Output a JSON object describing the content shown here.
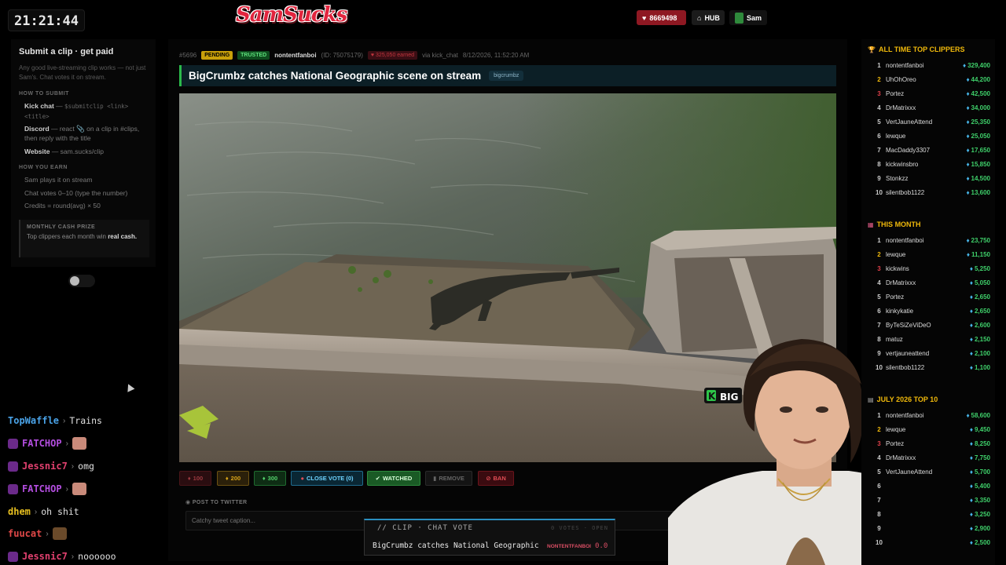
{
  "top_bar": {
    "clock": "21:21:44",
    "logo_text": "SamSucks",
    "points": "8669498",
    "hub_label": "HUB",
    "user_name": "Sam"
  },
  "info_panel": {
    "title": "Submit a clip · get paid",
    "description": "Any good live-streaming clip works — not just Sam's. Chat votes it on stream.",
    "how_to_submit_heading": "HOW TO SUBMIT",
    "submit_steps": [
      {
        "name": "Kick chat",
        "detail": "$submitclip <link> <title>"
      },
      {
        "name": "Discord",
        "detail": "— react 📎 on a clip in #clips, then reply with the title"
      },
      {
        "name": "Website",
        "detail": "— sam.sucks/clip"
      }
    ],
    "how_you_earn_heading": "HOW YOU EARN",
    "earn_steps": [
      "Sam plays it on stream",
      "Chat votes 0–10 (type the number)",
      "Credits = round(avg) × 50"
    ],
    "prize_heading": "MONTHLY CASH PRIZE",
    "prize_text": "Top clippers each month win",
    "prize_bold": "real cash."
  },
  "chat": [
    {
      "user": "TopWaffle",
      "color": "#4aa3e8",
      "message": "Trains",
      "badge": false,
      "emote": null
    },
    {
      "user": "FATCHOP",
      "color": "#b44ee0",
      "message": "",
      "badge": true,
      "emote": "face-emote"
    },
    {
      "user": "Jessnic7",
      "color": "#e0406e",
      "message": "omg",
      "badge": true,
      "emote": null
    },
    {
      "user": "FATCHOP",
      "color": "#b44ee0",
      "message": "",
      "badge": true,
      "emote": "face-emote"
    },
    {
      "user": "dhem",
      "color": "#e8c020",
      "message": "oh shit",
      "badge": false,
      "emote": null
    },
    {
      "user": "fuucat",
      "color": "#e04848",
      "message": "",
      "badge": false,
      "emote": "cat-emote"
    },
    {
      "user": "Jessnic7",
      "color": "#e0406e",
      "message": "noooooo",
      "badge": true,
      "emote": null
    }
  ],
  "clip": {
    "number": "#5696",
    "status": "PENDING",
    "trust": "TRUSTED",
    "submitter": "nontentfanboi",
    "submitter_id": "(ID: 75075179)",
    "earned": "325,050 earned",
    "source": "via kick_chat",
    "timestamp": "8/12/2026, 11:52:20 AM",
    "title": "BigCrumbz catches National Geographic scene on stream",
    "tag": "bigcrumbz",
    "watermark": "BIG"
  },
  "actions": {
    "vote_100": "100",
    "vote_200": "200",
    "vote_300": "300",
    "close_vote": "CLOSE VOTE (0)",
    "watched": "WATCHED",
    "remove": "REMOVE",
    "ban": "BAN"
  },
  "tweet": {
    "label": "POST TO TWITTER",
    "placeholder": "Catchy tweet caption..."
  },
  "vote_overlay": {
    "header": "// CLIP · CHAT VOTE",
    "status": "0 VOTES · OPEN",
    "title": "BigCrumbz catches National Geographic",
    "user": "NONTENTFANBOI",
    "score": "0.0"
  },
  "boards": {
    "all_time": {
      "title": "ALL TIME TOP CLIPPERS",
      "rows": [
        {
          "rank": "1",
          "name": "nontentfanboi",
          "value": "329,400"
        },
        {
          "rank": "2",
          "name": "UhOhOreo",
          "value": "44,200"
        },
        {
          "rank": "3",
          "name": "Portez",
          "value": "42,500"
        },
        {
          "rank": "4",
          "name": "DrMatrixxx",
          "value": "34,000"
        },
        {
          "rank": "5",
          "name": "VertJauneAttend",
          "value": "25,350"
        },
        {
          "rank": "6",
          "name": "lewque",
          "value": "25,050"
        },
        {
          "rank": "7",
          "name": "MacDaddy3307",
          "value": "17,650"
        },
        {
          "rank": "8",
          "name": "kickwinsbro",
          "value": "15,850"
        },
        {
          "rank": "9",
          "name": "Stonkzz",
          "value": "14,500"
        },
        {
          "rank": "10",
          "name": "silentbob1122",
          "value": "13,600"
        }
      ]
    },
    "this_month": {
      "title": "THIS MONTH",
      "rows": [
        {
          "rank": "1",
          "name": "nontentfanboi",
          "value": "23,750"
        },
        {
          "rank": "2",
          "name": "lewque",
          "value": "11,150"
        },
        {
          "rank": "3",
          "name": "kickwins",
          "value": "5,250"
        },
        {
          "rank": "4",
          "name": "DrMatrixxx",
          "value": "5,050"
        },
        {
          "rank": "5",
          "name": "Portez",
          "value": "2,650"
        },
        {
          "rank": "6",
          "name": "kinkykatie",
          "value": "2,650"
        },
        {
          "rank": "7",
          "name": "ByTeSiZeViDeO",
          "value": "2,600"
        },
        {
          "rank": "8",
          "name": "matuz",
          "value": "2,150"
        },
        {
          "rank": "9",
          "name": "vertjauneattend",
          "value": "2,100"
        },
        {
          "rank": "10",
          "name": "silentbob1122",
          "value": "1,100"
        }
      ]
    },
    "july": {
      "title": "JULY 2026 TOP 10",
      "rows": [
        {
          "rank": "1",
          "name": "nontentfanboi",
          "value": "58,600"
        },
        {
          "rank": "2",
          "name": "lewque",
          "value": "9,450"
        },
        {
          "rank": "3",
          "name": "Portez",
          "value": "8,250"
        },
        {
          "rank": "4",
          "name": "DrMatrixxx",
          "value": "7,750"
        },
        {
          "rank": "5",
          "name": "VertJauneAttend",
          "value": "5,700"
        },
        {
          "rank": "6",
          "name": "",
          "value": "5,400"
        },
        {
          "rank": "7",
          "name": "",
          "value": "3,350"
        },
        {
          "rank": "8",
          "name": "",
          "value": "3,250"
        },
        {
          "rank": "9",
          "name": "",
          "value": "2,900"
        },
        {
          "rank": "10",
          "name": "",
          "value": "2,500"
        }
      ]
    }
  },
  "colors": {
    "accent_green": "#2bb94a",
    "accent_gold": "#f0b90b",
    "accent_red": "#e0404a",
    "accent_cyan": "#2a8fbf"
  }
}
